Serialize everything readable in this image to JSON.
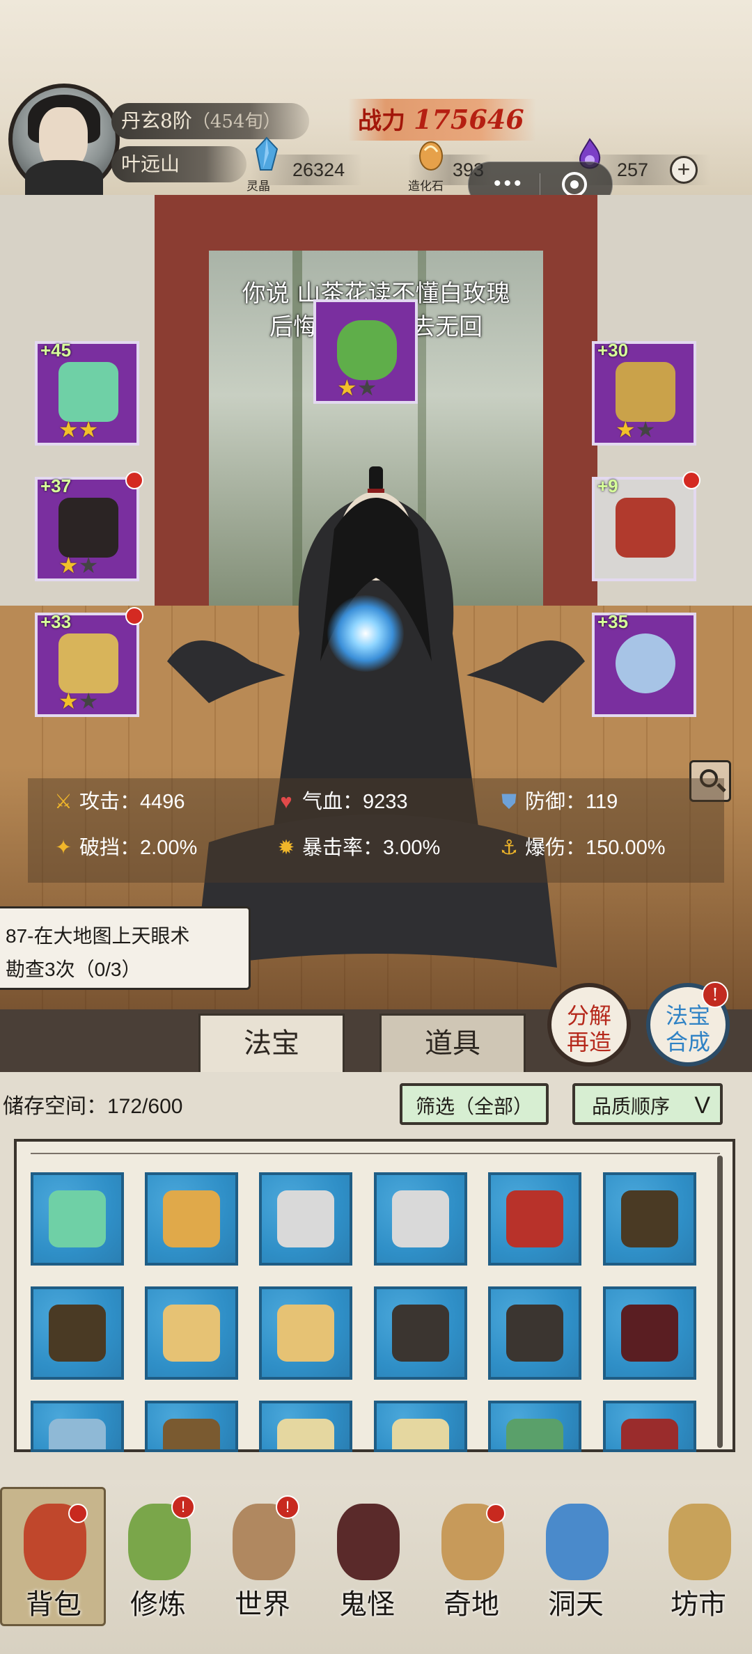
{
  "header": {
    "realm": "丹玄8阶",
    "realm_sub": "（454旬）",
    "player_name": "叶远山",
    "power_label": "战力",
    "power_value": "175646",
    "resources": [
      {
        "name": "灵晶",
        "value": "26324",
        "icon": "spirit-crystal-icon",
        "color": "#4fa6e0"
      },
      {
        "name": "造化石",
        "value": "393",
        "icon": "creation-stone-icon",
        "color": "#e6a14a"
      },
      {
        "name": "",
        "value": "257",
        "icon": "purple-flame-icon",
        "color": "#7b3fc6"
      }
    ],
    "plus_label": "+",
    "capsule_more": "•••"
  },
  "scene": {
    "lyrics_line1": "你说 山茶花读不懂白玫瑰",
    "lyrics_line2": "后悔的是爱有去无回"
  },
  "equipment": [
    {
      "slot": "weapon",
      "level": "+45",
      "stars": 2,
      "max_stars": 2,
      "alert": false,
      "rarity": "purple",
      "icon": "jade-mirror-icon"
    },
    {
      "slot": "head",
      "level": "",
      "stars": 1,
      "max_stars": 2,
      "alert": false,
      "rarity": "purple",
      "icon": "jade-crown-icon"
    },
    {
      "slot": "headband",
      "level": "+30",
      "stars": 1,
      "max_stars": 2,
      "alert": false,
      "rarity": "purple",
      "icon": "headband-icon"
    },
    {
      "slot": "robe",
      "level": "+37",
      "stars": 1,
      "max_stars": 2,
      "alert": true,
      "rarity": "purple",
      "icon": "dark-robe-icon"
    },
    {
      "slot": "necklace",
      "level": "+9",
      "stars": 0,
      "max_stars": 0,
      "alert": true,
      "rarity": "white",
      "icon": "bead-necklace-icon"
    },
    {
      "slot": "boots",
      "level": "+33",
      "stars": 1,
      "max_stars": 2,
      "alert": true,
      "rarity": "purple",
      "icon": "winged-boot-icon"
    },
    {
      "slot": "ring",
      "level": "+35",
      "stars": 0,
      "max_stars": 0,
      "alert": false,
      "rarity": "purple",
      "icon": "silver-ring-icon"
    }
  ],
  "stats": [
    {
      "label": "攻击",
      "value": "4496",
      "icon": "sword-icon"
    },
    {
      "label": "气血",
      "value": "9233",
      "icon": "heart-icon"
    },
    {
      "label": "防御",
      "value": "119",
      "icon": "shield-icon"
    },
    {
      "label": "破挡",
      "value": "2.00%",
      "icon": "break-icon"
    },
    {
      "label": "暴击率",
      "value": "3.00%",
      "icon": "crit-icon"
    },
    {
      "label": "爆伤",
      "value": "150.00%",
      "icon": "crit-damage-icon"
    }
  ],
  "quest": {
    "line1": "87-在大地图上天眼术",
    "line2": "勘查3次（0/3）"
  },
  "tabs": [
    "法宝",
    "道具"
  ],
  "round_buttons": {
    "decompose_line1": "分解",
    "decompose_line2": "再造",
    "synthesize_line1": "法宝",
    "synthesize_line2": "合成",
    "synthesize_badge": "!"
  },
  "inventory": {
    "storage_label": "储存空间：",
    "storage_value": "172/600",
    "filter_label": "筛选（全部）",
    "sort_label": "品质顺序",
    "sort_chevron": "V",
    "items": [
      {
        "icon": "jade-mirror-icon",
        "color": "#6fd0a6"
      },
      {
        "icon": "golden-crown-icon",
        "color": "#e0a94a"
      },
      {
        "icon": "white-robe-icon",
        "color": "#d9d9d9"
      },
      {
        "icon": "white-robe-icon",
        "color": "#d9d9d9"
      },
      {
        "icon": "red-armor-icon",
        "color": "#b8322a"
      },
      {
        "icon": "dark-robe-icon",
        "color": "#4a3a24"
      },
      {
        "icon": "dark-robe-icon",
        "color": "#4a3a24"
      },
      {
        "icon": "gold-armor-icon",
        "color": "#e6c274"
      },
      {
        "icon": "gold-armor-icon",
        "color": "#e6c274"
      },
      {
        "icon": "bracer-icon",
        "color": "#3b3530"
      },
      {
        "icon": "bracer-icon",
        "color": "#3b3530"
      },
      {
        "icon": "red-black-glove-icon",
        "color": "#5a1e22"
      },
      {
        "icon": "blue-item-icon",
        "color": "#8fb9d6"
      },
      {
        "icon": "staff-icon",
        "color": "#7a5a30"
      },
      {
        "icon": "spirit-item-icon",
        "color": "#e5d7a0"
      },
      {
        "icon": "spirit-item-icon",
        "color": "#e5d7a0"
      },
      {
        "icon": "wreath-icon",
        "color": "#5aa06a"
      },
      {
        "icon": "red-bracelet-icon",
        "color": "#9a2c2c"
      }
    ]
  },
  "nav": [
    {
      "label": "背包",
      "icon": "bag-icon",
      "color": "#c0472c",
      "badge": "",
      "selected": true
    },
    {
      "label": "修炼",
      "icon": "lotus-icon",
      "color": "#7aa64a",
      "badge": "!",
      "selected": false
    },
    {
      "label": "世界",
      "icon": "scroll-map-icon",
      "color": "#b08860",
      "badge": "!",
      "selected": false
    },
    {
      "label": "鬼怪",
      "icon": "demon-egg-icon",
      "color": "#5a2a2a",
      "badge": "",
      "selected": false
    },
    {
      "label": "奇地",
      "icon": "floating-island-icon",
      "color": "#c79a5a",
      "badge": "",
      "selected": false
    },
    {
      "label": "洞天",
      "icon": "portal-icon",
      "color": "#4a8acb",
      "badge": "",
      "selected": false
    },
    {
      "label": "坊市",
      "icon": "market-stall-icon",
      "color": "#c8a25a",
      "badge": "",
      "selected": false
    }
  ]
}
